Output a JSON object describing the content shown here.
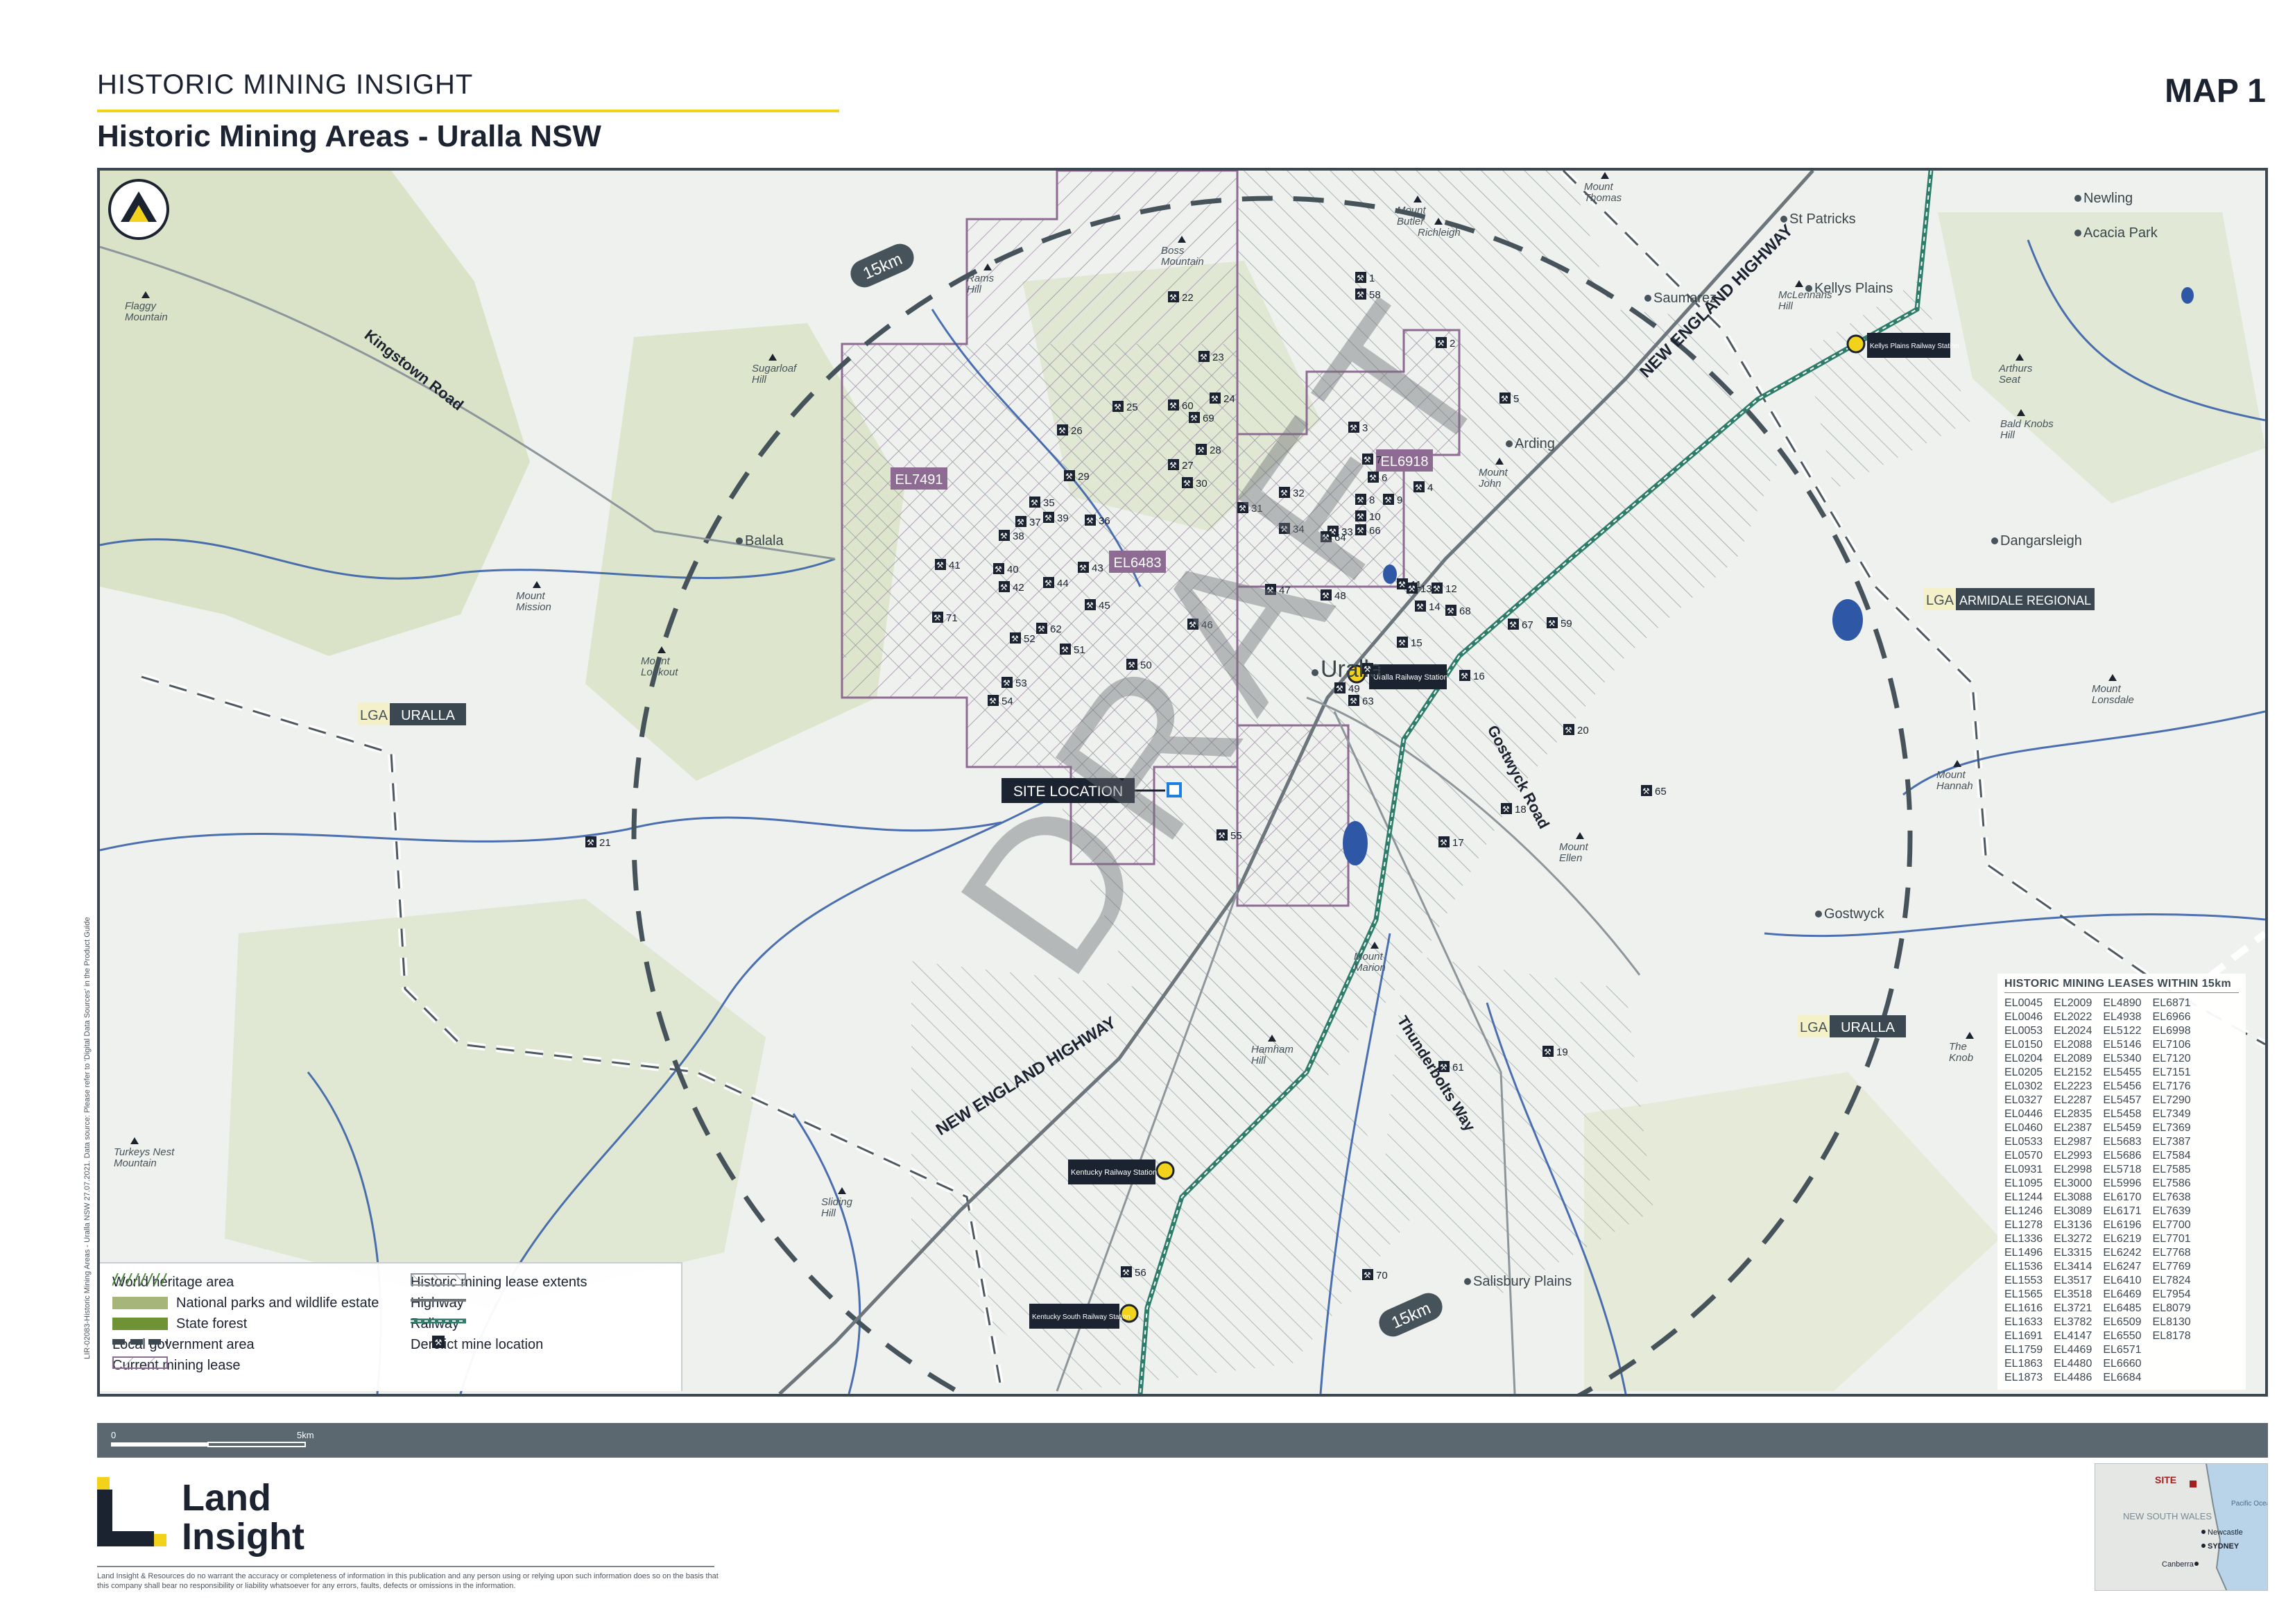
{
  "header": {
    "kicker": "HISTORIC MINING INSIGHT",
    "title": "Historic Mining Areas - Uralla NSW",
    "map_number": "MAP 1"
  },
  "map": {
    "watermark": "DRAFT",
    "ring_labels": [
      "15km",
      "15km"
    ],
    "lease_labels": [
      "EL7491",
      "EL6483",
      "EL6918"
    ],
    "site_location_label": "SITE LOCATION",
    "towns": [
      "Uralla",
      "Balala",
      "Arding",
      "Saumarez",
      "Kellys Plains",
      "St Patricks",
      "Dangarsleigh",
      "Gostwyck",
      "Salisbury Plains",
      "Newling",
      "Acacia Park"
    ],
    "places": [
      "Mount Thomas",
      "Mount Butler",
      "Richleigh",
      "Sugarloaf Hill",
      "Rams Hill",
      "Boss Mountain",
      "Mount Mission",
      "Mount Lookout",
      "Flaggy Mountain",
      "Turkeys Nest Mountain",
      "Mount Marion",
      "Mount Ellen",
      "Mount Lonsdale",
      "Mount Hannah",
      "Hamham Hill",
      "Sliding Hill",
      "McLennans Hill",
      "Arthurs Seat",
      "Bald Knobs Hill",
      "Mount John",
      "The Knob"
    ],
    "roads": [
      "NEW ENGLAND HIGHWAY",
      "NEW ENGLAND HIGHWAY",
      "Kingstown Road",
      "Gostwyck Road",
      "Thunderbolts Way"
    ],
    "stations": [
      "Uralla Railway Station",
      "Kellys Plains Railway Station",
      "Kentucky Railway Station",
      "Kentucky South Railway Station"
    ],
    "lga": [
      {
        "prefix": "LGA",
        "name": "URALLA"
      },
      {
        "prefix": "LGA",
        "name": "ARMIDALE REGIONAL"
      },
      {
        "prefix": "LGA",
        "name": "URALLA"
      }
    ],
    "mine_numbers": [
      "1",
      "2",
      "3",
      "4",
      "5",
      "6",
      "7",
      "8",
      "9",
      "10",
      "11",
      "12",
      "13",
      "14",
      "15",
      "16",
      "17",
      "18",
      "19",
      "20",
      "21",
      "22",
      "23",
      "24",
      "25",
      "26",
      "27",
      "28",
      "29",
      "30",
      "31",
      "32",
      "33",
      "34",
      "35",
      "36",
      "37",
      "38",
      "39",
      "40",
      "41",
      "42",
      "43",
      "44",
      "45",
      "46",
      "47",
      "48",
      "49",
      "50",
      "51",
      "52",
      "53",
      "54",
      "55",
      "56",
      "57",
      "58",
      "59",
      "60",
      "61",
      "62",
      "63",
      "64",
      "65",
      "66",
      "67",
      "68",
      "69",
      "70",
      "71"
    ]
  },
  "legend": {
    "items": [
      {
        "label": "World heritage area",
        "swatch": "heritage"
      },
      {
        "label": "National parks and wildlife estate",
        "swatch": "parks"
      },
      {
        "label": "State forest",
        "swatch": "forest"
      },
      {
        "label": "Local government area",
        "swatch": "lga"
      },
      {
        "label": "Current mining lease",
        "swatch": "current"
      },
      {
        "label": "Historic mining lease extents",
        "swatch": "historic"
      },
      {
        "label": "Highway",
        "swatch": "highway"
      },
      {
        "label": "Railway",
        "swatch": "railway"
      },
      {
        "label": "Derelict mine location",
        "swatch": "mine"
      }
    ]
  },
  "leases": {
    "title": "HISTORIC MINING LEASES WITHIN 15km",
    "columns": [
      [
        "EL0045",
        "EL0046",
        "EL0053",
        "EL0150",
        "EL0204",
        "EL0205",
        "EL0302",
        "EL0327",
        "EL0446",
        "EL0460",
        "EL0533",
        "EL0570",
        "EL0931",
        "EL1095",
        "EL1244",
        "EL1246",
        "EL1278",
        "EL1336",
        "EL1496",
        "EL1536",
        "EL1553",
        "EL1565",
        "EL1616",
        "EL1633",
        "EL1691",
        "EL1759",
        "EL1863",
        "EL1873"
      ],
      [
        "EL2009",
        "EL2022",
        "EL2024",
        "EL2088",
        "EL2089",
        "EL2152",
        "EL2223",
        "EL2287",
        "EL2835",
        "EL2387",
        "EL2987",
        "EL2993",
        "EL2998",
        "EL3000",
        "EL3088",
        "EL3089",
        "EL3136",
        "EL3272",
        "EL3315",
        "EL3414",
        "EL3517",
        "EL3518",
        "EL3721",
        "EL3782",
        "EL4147",
        "EL4469",
        "EL4480",
        "EL4486"
      ],
      [
        "EL4890",
        "EL4938",
        "EL5122",
        "EL5146",
        "EL5340",
        "EL5455",
        "EL5456",
        "EL5457",
        "EL5458",
        "EL5459",
        "EL5683",
        "EL5686",
        "EL5718",
        "EL5996",
        "EL6170",
        "EL6171",
        "EL6196",
        "EL6219",
        "EL6242",
        "EL6247",
        "EL6410",
        "EL6469",
        "EL6485",
        "EL6509",
        "EL6550",
        "EL6571",
        "EL6660",
        "EL6684"
      ],
      [
        "EL6871",
        "EL6966",
        "EL6998",
        "EL7106",
        "EL7120",
        "EL7151",
        "EL7176",
        "EL7290",
        "EL7349",
        "EL7369",
        "EL7387",
        "EL7584",
        "EL7585",
        "EL7586",
        "EL7638",
        "EL7639",
        "EL7700",
        "EL7701",
        "EL7768",
        "EL7769",
        "EL7824",
        "EL7954",
        "EL8079",
        "EL8130",
        "EL8178"
      ]
    ]
  },
  "scale": {
    "start": "0",
    "end": "5km"
  },
  "logo": {
    "line1": "Land",
    "line2": "Insight"
  },
  "disclaimer": "Land Insight & Resources do no warrant the accuracy or completeness of information in this publication and any person using or relying upon such information does so on the basis that this company shall bear no responsibility or liability whatsoever for any errors, faults, defects or omissions in the information.",
  "side_note": "LIR-02083-Historic Mining Areas - Uralla NSW 27.07.2021. Data source: Please refer to 'Digital Data Sources' in the Product Guide",
  "inset": {
    "state": "NEW SOUTH WALES",
    "site": "SITE",
    "cities": [
      "Newcastle",
      "SYDNEY",
      "Canberra"
    ],
    "ocean": "Pacific Ocean"
  },
  "colors": {
    "frame": "#3b4852",
    "accent": "#f3d21b",
    "lease": "#8d6b93",
    "river": "#2e58a6",
    "parks": "#a6b67a",
    "forest": "#6e9234"
  }
}
